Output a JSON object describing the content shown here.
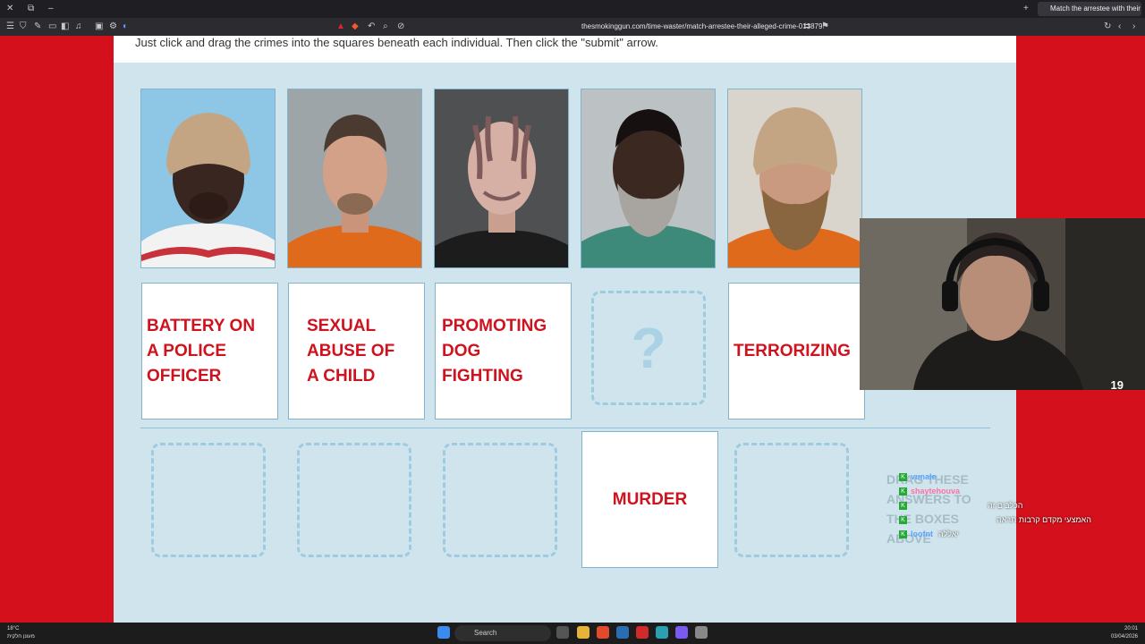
{
  "browser": {
    "tab_title": "Match the arrestee with their alle",
    "url": "thesmokinggun.com/time-waster/match-arrestee-their-alleged-crime-013879"
  },
  "page": {
    "instructions": "Just click and drag the crimes into the squares beneath each individual. Then click the \"submit\" arrow.",
    "slots": [
      {
        "crime_lines": [
          "BATTERY ON",
          "A POLICE",
          "OFFICER"
        ]
      },
      {
        "crime_lines": [
          "SEXUAL",
          "ABUSE OF",
          "A CHILD"
        ]
      },
      {
        "crime_lines": [
          "PROMOTING",
          "DOG",
          "FIGHTING"
        ]
      },
      {
        "placeholder": "?"
      },
      {
        "crime_lines": [
          "TERRORIZING"
        ]
      }
    ],
    "answer_choice": "MURDER",
    "side_hint": "DRAG THESE ANSWERS TO THE BOXES ABOVE"
  },
  "stream": {
    "viewer_count": "19",
    "chat": [
      {
        "user": "vunale",
        "message": ""
      },
      {
        "user": "shaytehouva",
        "message": ""
      },
      {
        "user": "",
        "message": "הכלבים זה"
      },
      {
        "user": "",
        "message": "האמצעי מקדם קרבות תראה"
      },
      {
        "user": "loofnt",
        "message": "יאללה"
      }
    ]
  },
  "taskbar": {
    "weather_temp": "18°C",
    "weather_desc": "מעונן חלקית",
    "search_placeholder": "Search",
    "time": "20:01",
    "date": "03/04/2026"
  }
}
